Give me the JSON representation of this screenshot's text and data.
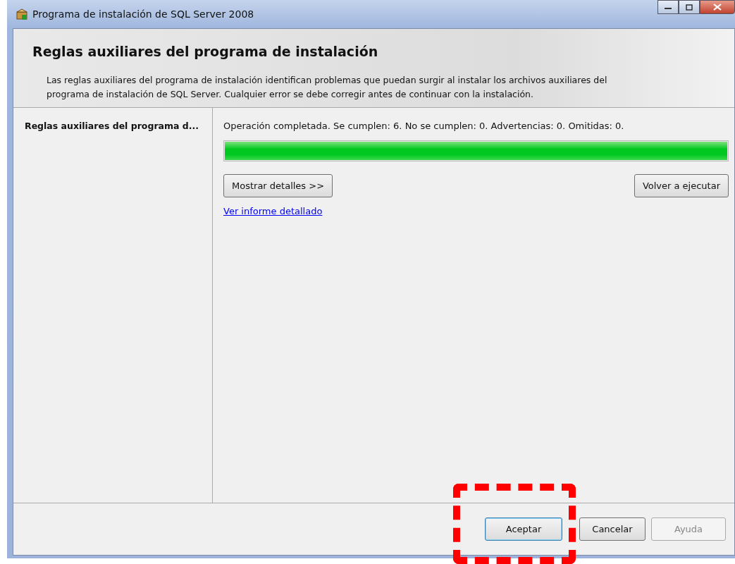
{
  "window": {
    "title": "Programa de instalación de SQL Server 2008"
  },
  "header": {
    "title": "Reglas auxiliares del programa de instalación",
    "description": "Las reglas auxiliares del programa de instalación identifican problemas que puedan surgir al instalar los archivos auxiliares del programa de instalación de SQL Server. Cualquier error se debe corregir antes de continuar con la instalación."
  },
  "sidebar": {
    "items": [
      {
        "label": "Reglas auxiliares del programa d...",
        "selected": true
      }
    ]
  },
  "status": "Operación completada. Se cumplen: 6. No se cumplen: 0. Advertencias: 0. Omitidas: 0.",
  "progress": {
    "level": 1
  },
  "show_details_button": "Mostrar detalles >>",
  "rerun_button": "Volver a ejecutar",
  "report_link": "Ver informe detallado",
  "buttons": [
    {
      "label": "Aceptar",
      "default": true,
      "disabled": false
    },
    {
      "label": "Cancelar",
      "default": false,
      "disabled": false
    },
    {
      "label": "Ayuda",
      "default": false,
      "disabled": true
    }
  ]
}
